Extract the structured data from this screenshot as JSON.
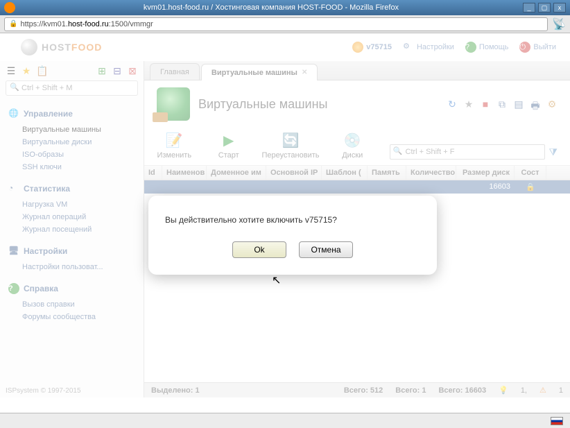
{
  "window": {
    "title": "kvm01.host-food.ru / Хостинговая компания HOST-FOOD - Mozilla Firefox",
    "url_prefix": "https://kvm01.",
    "url_host": "host-food.ru",
    "url_suffix": ":1500/vmmgr"
  },
  "logo": {
    "part1": "HOST",
    "part2": "FOOD"
  },
  "toplinks": {
    "user": "v75715",
    "settings": "Настройки",
    "help": "Помощь",
    "logout": "Выйти"
  },
  "sidebar": {
    "search_placeholder": "Ctrl + Shift + M",
    "sections": [
      {
        "title": "Управление",
        "items": [
          "Виртуальные машины",
          "Виртуальные диски",
          "ISO-образы",
          "SSH ключи"
        ],
        "active": 0
      },
      {
        "title": "Статистика",
        "items": [
          "Нагрузка VM",
          "Журнал операций",
          "Журнал посещений"
        ]
      },
      {
        "title": "Настройки",
        "items": [
          "Настройки пользоват..."
        ]
      },
      {
        "title": "Справка",
        "items": [
          "Вызов справки",
          "Форумы сообщества"
        ]
      }
    ],
    "footer": "ISPsystem © 1997-2015"
  },
  "tabs": [
    {
      "label": "Главная",
      "active": false
    },
    {
      "label": "Виртуальные машины",
      "active": true
    }
  ],
  "page": {
    "title": "Виртуальные машины",
    "actions": {
      "edit": "Изменить",
      "start": "Старт",
      "reinstall": "Переустановить",
      "disks": "Диски"
    },
    "filter_placeholder": "Ctrl + Shift + F",
    "columns": {
      "id": "Id",
      "name": "Наименов",
      "domain": "Доменное им",
      "ip": "Основной IP",
      "tpl": "Шаблон (",
      "mem": "Память",
      "count": "Количество",
      "disk": "Размер диск",
      "state": "Сост"
    },
    "row": {
      "disk": "16603"
    }
  },
  "dialog": {
    "message": "Вы действительно хотите включить v75715?",
    "ok": "Ok",
    "cancel": "Отмена"
  },
  "status": {
    "selected_label": "Выделено: 1",
    "total1": "Всего: 512",
    "total2": "Всего: 1",
    "total3": "Всего: 16603",
    "bulb": "1,",
    "warn": "1"
  }
}
